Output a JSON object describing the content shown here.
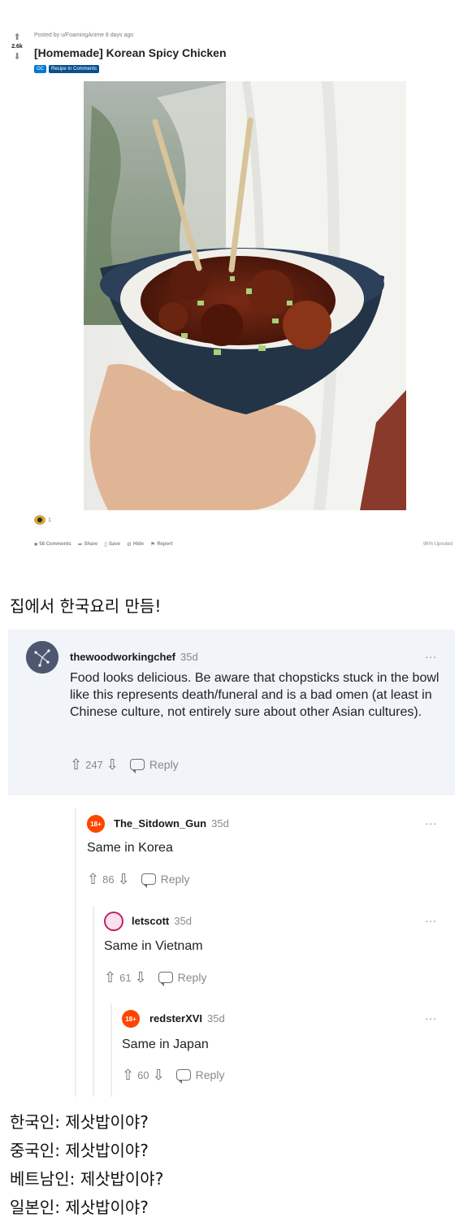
{
  "post": {
    "vote_count": "2.6k",
    "meta": "Posted by u/FoamingAnime 8 days ago",
    "title": "[Homemade] Korean Spicy Chicken",
    "flairs": [
      "OC",
      "Recipe In Comments"
    ],
    "award_count": "1",
    "actions": {
      "comments": "58 Comments",
      "share": "Share",
      "save": "Save",
      "hide": "Hide",
      "report": "Report"
    },
    "upvoted": "96% Upvoted",
    "photo_alt": "hand-holding-bowl-image"
  },
  "caption": "집에서 한국요리 만듬!",
  "comments": [
    {
      "author": "thewoodworkingchef",
      "age": "35d",
      "body": "Food looks delicious. Be aware that chopsticks stuck in the bowl like this represents death/funeral and is a bad omen (at least in Chinese culture, not entirely sure about other Asian cultures).",
      "votes": "247",
      "reply": "Reply"
    },
    {
      "author": "The_Sitdown_Gun",
      "age": "35d",
      "body": "Same in Korea",
      "votes": "86",
      "reply": "Reply",
      "avatar_badge": "18+"
    },
    {
      "author": "letscott",
      "age": "35d",
      "body": "Same in Vietnam",
      "votes": "61",
      "reply": "Reply"
    },
    {
      "author": "redsterXVI",
      "age": "35d",
      "body": "Same in Japan",
      "votes": "60",
      "reply": "Reply",
      "avatar_badge": "18+"
    }
  ],
  "more_label": "...",
  "reactions": [
    "한국인: 제삿밥이야?",
    "중국인:  제삿밥이야?",
    "베트남인: 제삿밥이야?",
    "일본인: 제삿밥이야?"
  ],
  "colors": {
    "accent": "#0079d3",
    "nsfw": "#ff4500",
    "comment_bg": "#f1f4f8"
  }
}
